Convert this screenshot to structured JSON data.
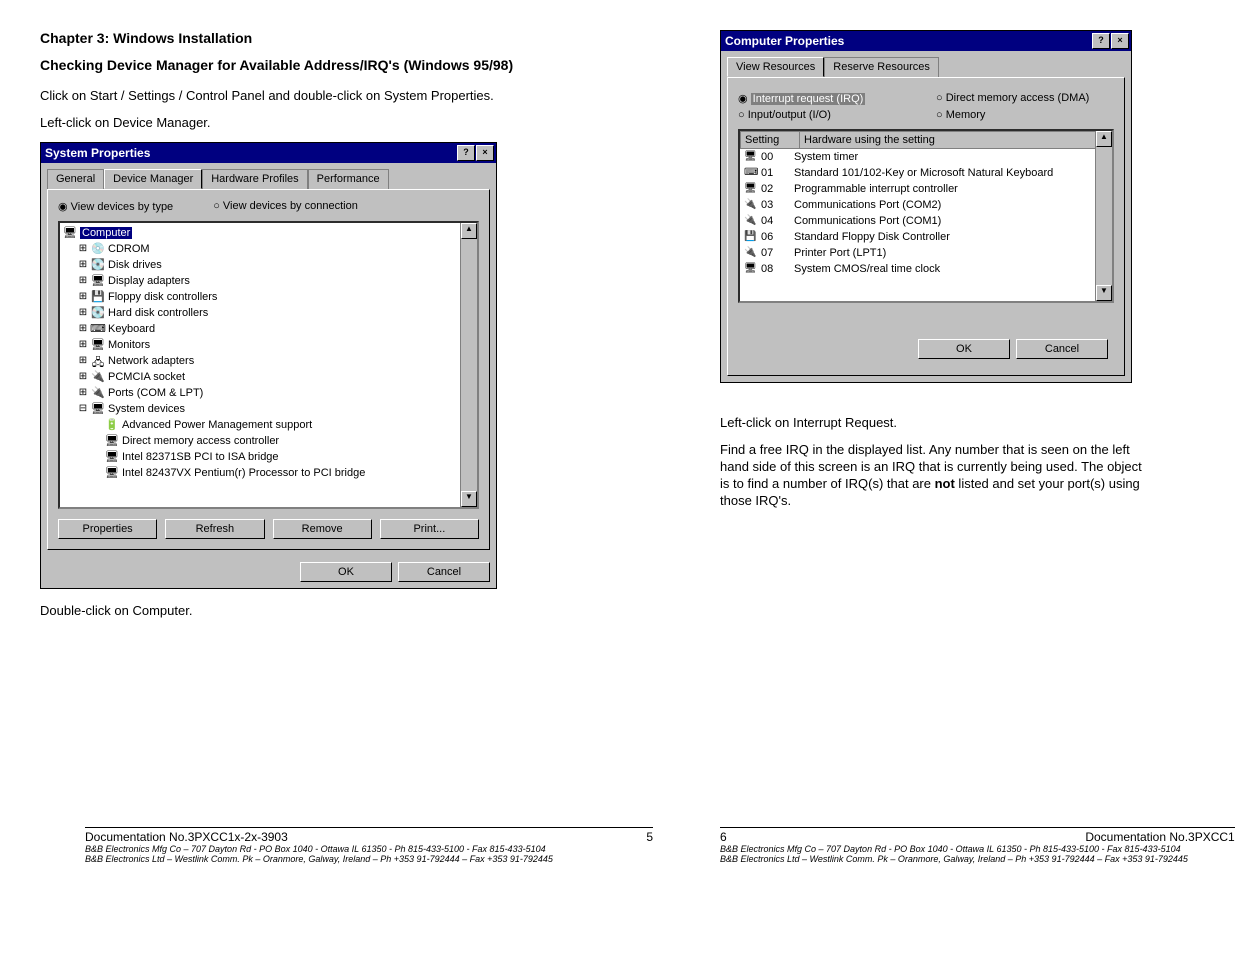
{
  "chapter": "Chapter 3:  Windows Installation",
  "subhead": "Checking Device Manager for Available Address/IRQ's (Windows 95/98)",
  "para1": "Click on Start / Settings / Control Panel and double-click on System Properties.",
  "para2": "Left-click on Device Manager.",
  "para3": "Double-click on Computer.",
  "rpara1": "Left-click on Interrupt Request.",
  "rpara2a": "Find a free IRQ in the displayed list. Any number that is seen on the left hand side of this screen is an IRQ that is currently being used. The object is to find a number of IRQ(s) that are ",
  "rpara2b": "not",
  "rpara2c": " listed and set your port(s) using those IRQ's.",
  "sysprop": {
    "title": "System Properties",
    "help": "?",
    "close": "×",
    "tabs": [
      "General",
      "Device Manager",
      "Hardware Profiles",
      "Performance"
    ],
    "radio1": "View devices by type",
    "radio2": "View devices by connection",
    "tree": {
      "root": "Computer",
      "cdrom": "CDROM",
      "disk": "Disk drives",
      "disp": "Display adapters",
      "floppy": "Floppy disk controllers",
      "hdd": "Hard disk controllers",
      "kbd": "Keyboard",
      "mon": "Monitors",
      "net": "Network adapters",
      "pcmcia": "PCMCIA socket",
      "ports": "Ports (COM & LPT)",
      "sys": "System devices",
      "apm": "Advanced Power Management support",
      "dma": "Direct memory access controller",
      "isa": "Intel 82371SB PCI to ISA bridge",
      "pci": "Intel 82437VX Pentium(r) Processor to PCI bridge"
    },
    "btns": {
      "prop": "Properties",
      "refresh": "Refresh",
      "remove": "Remove",
      "print": "Print..."
    },
    "ok": "OK",
    "cancel": "Cancel"
  },
  "compprop": {
    "title": "Computer Properties",
    "tabs": [
      "View Resources",
      "Reserve Resources"
    ],
    "r_irq": "Interrupt request (IRQ)",
    "r_dma": "Direct memory access (DMA)",
    "r_io": "Input/output (I/O)",
    "r_mem": "Memory",
    "hdr_setting": "Setting",
    "hdr_hw": "Hardware using the setting",
    "rows": [
      {
        "s": "00",
        "h": "System timer",
        "ico": "🖥"
      },
      {
        "s": "01",
        "h": "Standard 101/102-Key or Microsoft Natural Keyboard",
        "ico": "⌨"
      },
      {
        "s": "02",
        "h": "Programmable interrupt controller",
        "ico": "🖥"
      },
      {
        "s": "03",
        "h": "Communications Port (COM2)",
        "ico": "🔌"
      },
      {
        "s": "04",
        "h": "Communications Port (COM1)",
        "ico": "🔌"
      },
      {
        "s": "06",
        "h": "Standard Floppy Disk Controller",
        "ico": "💾"
      },
      {
        "s": "07",
        "h": "Printer Port (LPT1)",
        "ico": "🔌"
      },
      {
        "s": "08",
        "h": "System CMOS/real time clock",
        "ico": "🖥"
      }
    ],
    "ok": "OK",
    "cancel": "Cancel"
  },
  "footer": {
    "doc": "Documentation No.3PXCC1x-2x-3903",
    "p5": "5",
    "p6": "6",
    "l1": "B&B Electronics Mfg Co – 707 Dayton Rd - PO Box 1040 - Ottawa IL 61350 - Ph 815-433-5100 - Fax 815-433-5104",
    "l2": "B&B Electronics Ltd – Westlink Comm. Pk – Oranmore, Galway, Ireland – Ph +353 91-792444 – Fax +353 91-792445"
  }
}
